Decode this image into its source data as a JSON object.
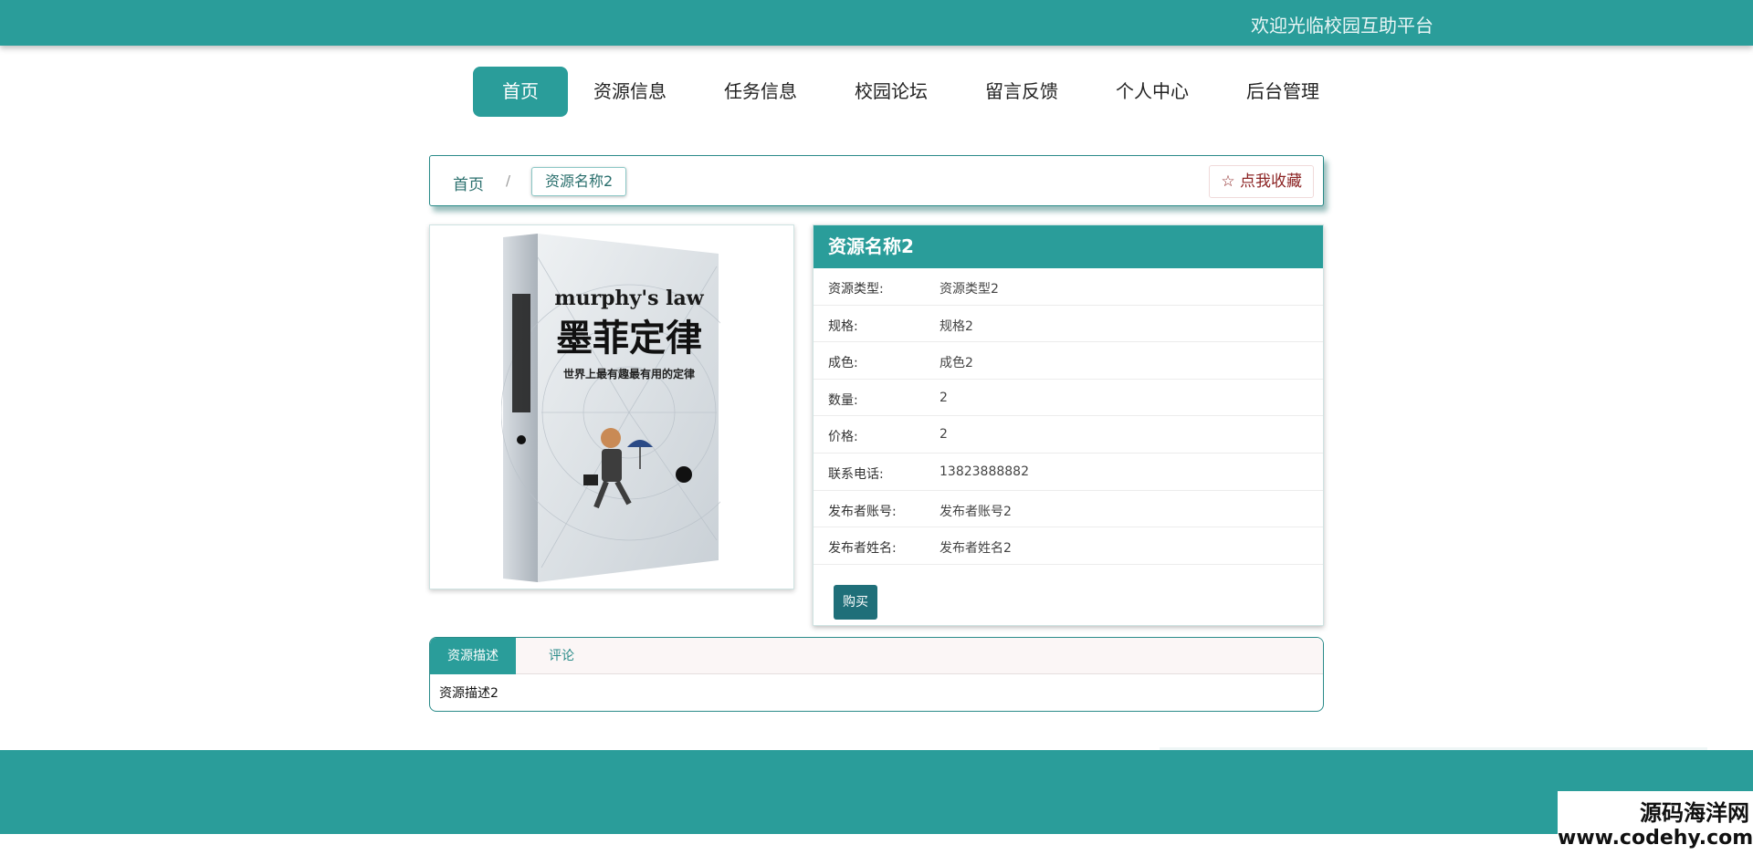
{
  "header": {
    "welcome": "欢迎光临校园互助平台"
  },
  "nav": {
    "items": [
      "首页",
      "资源信息",
      "任务信息",
      "校园论坛",
      "留言反馈",
      "个人中心",
      "后台管理"
    ]
  },
  "breadcrumb": {
    "home": "首页",
    "separator": "/",
    "current": "资源名称2",
    "favorite": "☆ 点我收藏"
  },
  "detail": {
    "title": "资源名称2",
    "fields": [
      {
        "label": "资源类型:",
        "value": "资源类型2"
      },
      {
        "label": "规格:",
        "value": "规格2"
      },
      {
        "label": "成色:",
        "value": "成色2"
      },
      {
        "label": "数量:",
        "value": "2"
      },
      {
        "label": "价格:",
        "value": "2"
      },
      {
        "label": "联系电话:",
        "value": "13823888882"
      },
      {
        "label": "发布者账号:",
        "value": "发布者账号2"
      },
      {
        "label": "发布者姓名:",
        "value": "发布者姓名2"
      }
    ],
    "buy_label": "购买"
  },
  "book_cover": {
    "en_title": "murphy's law",
    "cn_title": "墨菲定律",
    "subtitle": "世界上最有趣最有用的定律"
  },
  "tabs": {
    "items": [
      "资源描述",
      "评论"
    ],
    "content": "资源描述2"
  },
  "watermark": {
    "line1": "源码海洋网",
    "line2": "www.codehy.com"
  },
  "colors": {
    "primary": "#2a9d9a",
    "buy": "#1f6f79",
    "favorite_text": "#8c2424"
  }
}
